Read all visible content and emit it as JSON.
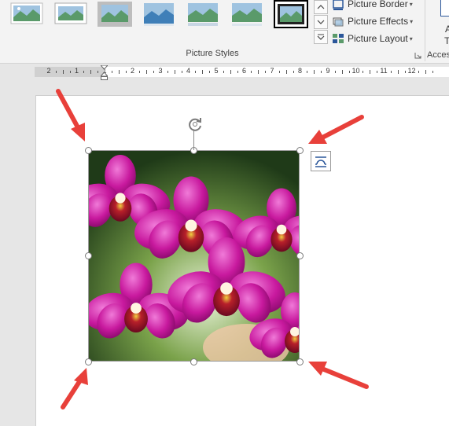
{
  "ribbon": {
    "group_label": "Picture Styles",
    "commands": [
      {
        "label": "Picture Border",
        "icon": "picture-border-icon"
      },
      {
        "label": "Picture Effects",
        "icon": "picture-effects-icon"
      },
      {
        "label": "Picture Layout",
        "icon": "picture-layout-icon"
      }
    ],
    "access_label": "Acces",
    "access_a": "A",
    "access_t": "Te"
  },
  "ruler": {
    "labels": [
      "2",
      "1",
      "1",
      "2",
      "3",
      "4",
      "5",
      "6",
      "7",
      "8",
      "9",
      "10",
      "11",
      "12"
    ]
  },
  "colors": {
    "accent": "#2b579a",
    "arrow": "#e8403a",
    "orchid": "#c01a9a"
  }
}
